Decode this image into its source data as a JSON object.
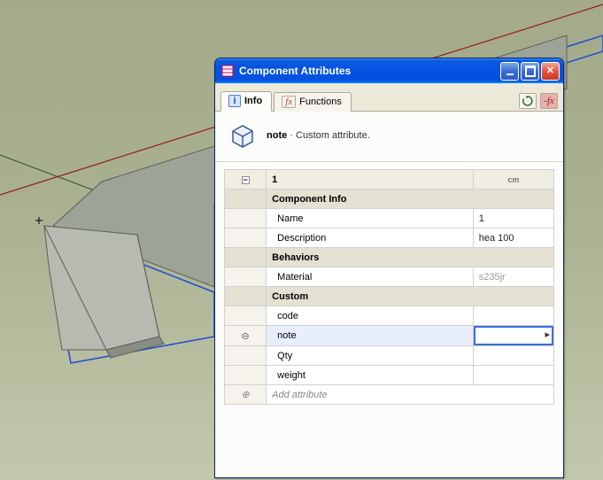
{
  "window": {
    "title": "Component Attributes"
  },
  "tabs": {
    "info": "Info",
    "functions": "Functions"
  },
  "toolbar": {
    "refresh_icon": "refresh-icon",
    "fx_icon": "fx-toggle-icon"
  },
  "header": {
    "attr_name": "note",
    "attr_desc": " · Custom attribute."
  },
  "grid": {
    "component_name": "1",
    "units_label": "cm",
    "sections": {
      "component_info": {
        "title": "Component Info",
        "rows": {
          "name": {
            "key": "Name",
            "val": "1"
          },
          "description": {
            "key": "Description",
            "val": "hea 100"
          }
        }
      },
      "behaviors": {
        "title": "Behaviors",
        "rows": {
          "material": {
            "key": "Material",
            "val": "s235jr"
          }
        }
      },
      "custom": {
        "title": "Custom",
        "rows": {
          "code": {
            "key": "code",
            "val": ""
          },
          "note": {
            "key": "note",
            "val": ""
          },
          "qty": {
            "key": "Qty",
            "val": ""
          },
          "weight": {
            "key": "weight",
            "val": ""
          }
        }
      }
    },
    "add_row": "Add attribute"
  }
}
